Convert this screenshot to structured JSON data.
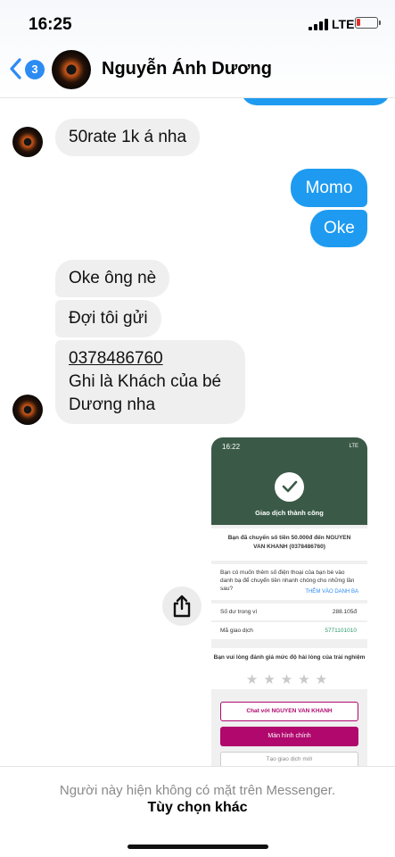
{
  "status_bar": {
    "time": "16:25",
    "network": "LTE"
  },
  "header": {
    "back_badge": "3",
    "contact_name": "Nguyễn Ánh Dương"
  },
  "messages": {
    "m1": "50rate 1k á nha",
    "m2": "Momo",
    "m3": "Oke",
    "m4": "Oke ông nè",
    "m5": "Đợi tôi gửi",
    "m6_phone": "0378486760",
    "m6_line2": "Ghi là Khách của bé",
    "m6_line3": "Dương nha"
  },
  "receipt": {
    "time": "16:22",
    "network": "LTE",
    "success": "Giao dịch thành công",
    "description": "Bạn đã chuyển số tiền 50.000đ đến NGUYEN VAN KHANH (0378486760)",
    "ask": "Bạn có muốn thêm số điện thoại của bạn bè vào danh bạ để chuyển tiền nhanh chóng cho những lần sau?",
    "add_link": "THÊM VÀO DANH BẠ",
    "balance_label": "Số dư trong ví",
    "balance_value": "288.105đ",
    "txn_label": "Mã giao dịch",
    "txn_value": "5771101010",
    "rating_prompt": "Bạn vui lòng đánh giá mức độ hài lòng của trải nghiệm",
    "stars": "★★★★★",
    "chat_button": "Chat với NGUYEN VAN KHANH",
    "main_button": "Màn hình chính",
    "new_button": "Tạo giao dịch mới"
  },
  "footer": {
    "note": "Người này hiện không có mặt trên Messenger.",
    "options": "Tùy chọn khác"
  },
  "colors": {
    "accent": "#1e9bf0",
    "badge": "#2c8cf2",
    "momo_magenta": "#b0086d",
    "receipt_header": "#3a5a47"
  },
  "icons": [
    "chevron-left-icon",
    "share-icon",
    "check-icon",
    "signal-icon",
    "battery-icon"
  ]
}
